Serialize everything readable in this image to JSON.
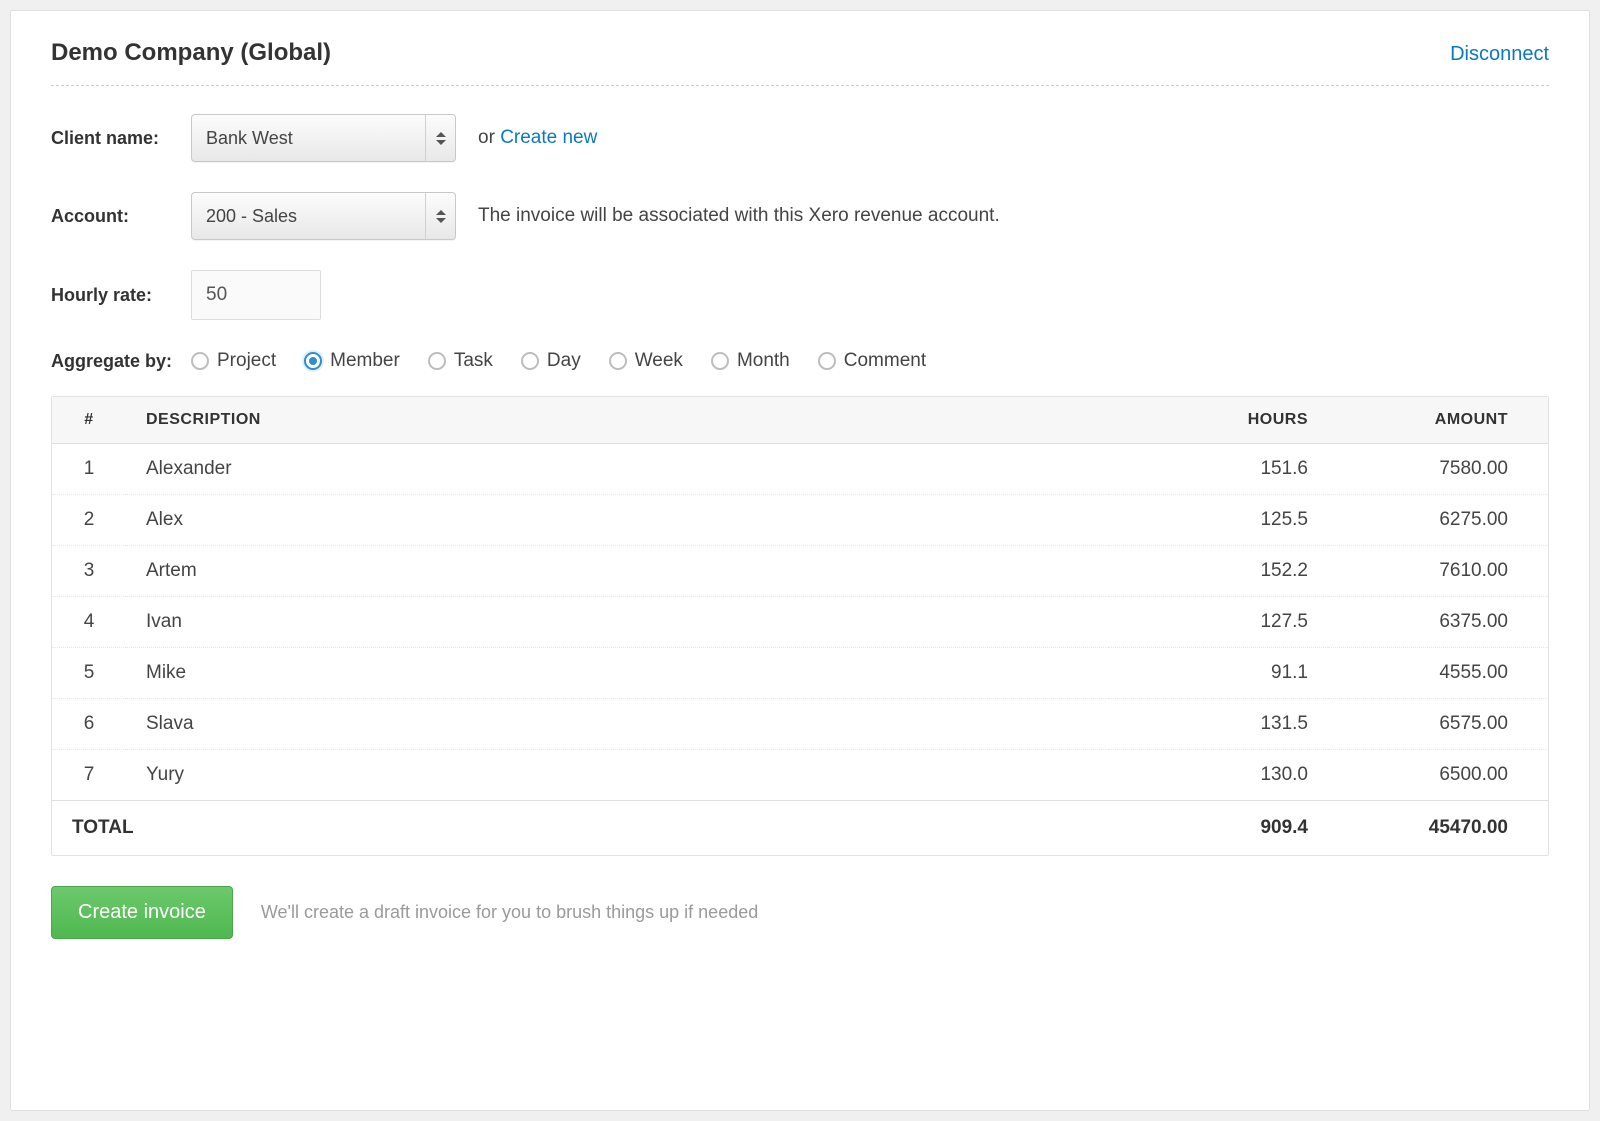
{
  "header": {
    "company_title": "Demo Company (Global)",
    "disconnect_label": "Disconnect"
  },
  "form": {
    "client_label": "Client name:",
    "client_selected": "Bank West",
    "client_or_text": "or ",
    "client_create_link": "Create new",
    "account_label": "Account:",
    "account_selected": "200 - Sales",
    "account_hint": "The invoice will be associated with this Xero revenue account.",
    "rate_label": "Hourly rate:",
    "rate_value": "50",
    "aggregate_label": "Aggregate by:"
  },
  "aggregate_options": [
    {
      "label": "Project",
      "selected": false
    },
    {
      "label": "Member",
      "selected": true
    },
    {
      "label": "Task",
      "selected": false
    },
    {
      "label": "Day",
      "selected": false
    },
    {
      "label": "Week",
      "selected": false
    },
    {
      "label": "Month",
      "selected": false
    },
    {
      "label": "Comment",
      "selected": false
    }
  ],
  "table": {
    "headers": {
      "num": "#",
      "desc": "DESCRIPTION",
      "hours": "HOURS",
      "amount": "AMOUNT"
    },
    "rows": [
      {
        "num": "1",
        "desc": "Alexander",
        "hours": "151.6",
        "amount": "7580.00"
      },
      {
        "num": "2",
        "desc": "Alex",
        "hours": "125.5",
        "amount": "6275.00"
      },
      {
        "num": "3",
        "desc": "Artem",
        "hours": "152.2",
        "amount": "7610.00"
      },
      {
        "num": "4",
        "desc": "Ivan",
        "hours": "127.5",
        "amount": "6375.00"
      },
      {
        "num": "5",
        "desc": "Mike",
        "hours": "91.1",
        "amount": "4555.00"
      },
      {
        "num": "6",
        "desc": "Slava",
        "hours": "131.5",
        "amount": "6575.00"
      },
      {
        "num": "7",
        "desc": "Yury",
        "hours": "130.0",
        "amount": "6500.00"
      }
    ],
    "total_label": "TOTAL",
    "total_hours": "909.4",
    "total_amount": "45470.00"
  },
  "footer": {
    "create_button": "Create invoice",
    "hint": "We'll create a draft invoice for you to brush things up if needed"
  }
}
